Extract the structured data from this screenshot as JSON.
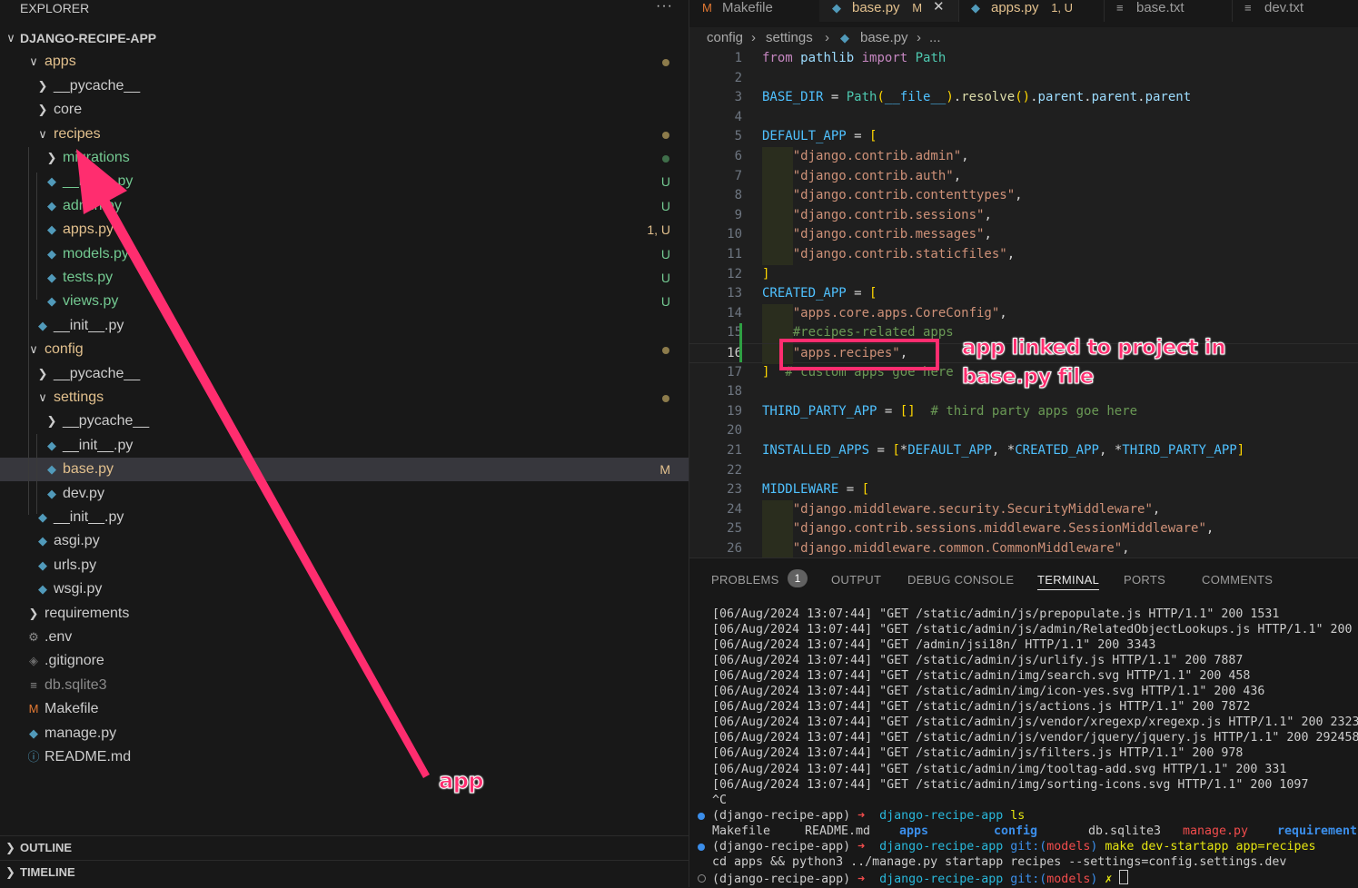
{
  "explorer": {
    "title": "EXPLORER",
    "more_actions": "···",
    "root": "DJANGO-RECIPE-APP",
    "items": [
      {
        "label": "apps",
        "type": "folder",
        "open": true,
        "indent": 1,
        "color": "#e2c08d",
        "dot": "#8c7b4b"
      },
      {
        "label": "__pycache__",
        "type": "folder",
        "open": false,
        "indent": 2,
        "color": "#cccccc"
      },
      {
        "label": "core",
        "type": "folder",
        "open": false,
        "indent": 2,
        "color": "#cccccc"
      },
      {
        "label": "recipes",
        "type": "folder",
        "open": true,
        "indent": 2,
        "color": "#e2c08d",
        "dot": "#8c7b4b"
      },
      {
        "label": "migrations",
        "type": "folder",
        "open": false,
        "indent": 3,
        "color": "#73c991",
        "dot": "#3f6e4a"
      },
      {
        "label": "__init__.py",
        "type": "py",
        "indent": 3,
        "color": "#73c991",
        "badge": "U",
        "badge_color": "#73c991"
      },
      {
        "label": "admin.py",
        "type": "py",
        "indent": 3,
        "color": "#73c991",
        "badge": "U",
        "badge_color": "#73c991"
      },
      {
        "label": "apps.py",
        "type": "py",
        "indent": 3,
        "color": "#e2c08d",
        "badge": "1, U",
        "badge_color": "#e2c08d"
      },
      {
        "label": "models.py",
        "type": "py",
        "indent": 3,
        "color": "#73c991",
        "badge": "U",
        "badge_color": "#73c991"
      },
      {
        "label": "tests.py",
        "type": "py",
        "indent": 3,
        "color": "#73c991",
        "badge": "U",
        "badge_color": "#73c991"
      },
      {
        "label": "views.py",
        "type": "py",
        "indent": 3,
        "color": "#73c991",
        "badge": "U",
        "badge_color": "#73c991"
      },
      {
        "label": "__init__.py",
        "type": "py",
        "indent": 2,
        "color": "#cccccc"
      },
      {
        "label": "config",
        "type": "folder",
        "open": true,
        "indent": 1,
        "color": "#e2c08d",
        "dot": "#8c7b4b"
      },
      {
        "label": "__pycache__",
        "type": "folder",
        "open": false,
        "indent": 2,
        "color": "#cccccc"
      },
      {
        "label": "settings",
        "type": "folder",
        "open": true,
        "indent": 2,
        "color": "#e2c08d",
        "dot": "#8c7b4b"
      },
      {
        "label": "__pycache__",
        "type": "folder",
        "open": false,
        "indent": 3,
        "color": "#cccccc"
      },
      {
        "label": "__init__.py",
        "type": "py",
        "indent": 3,
        "color": "#cccccc"
      },
      {
        "label": "base.py",
        "type": "py",
        "indent": 3,
        "color": "#e2c08d",
        "badge": "M",
        "badge_color": "#e2c08d",
        "selected": true
      },
      {
        "label": "dev.py",
        "type": "py",
        "indent": 3,
        "color": "#cccccc"
      },
      {
        "label": "__init__.py",
        "type": "py",
        "indent": 2,
        "color": "#cccccc"
      },
      {
        "label": "asgi.py",
        "type": "py",
        "indent": 2,
        "color": "#cccccc"
      },
      {
        "label": "urls.py",
        "type": "py",
        "indent": 2,
        "color": "#cccccc"
      },
      {
        "label": "wsgi.py",
        "type": "py",
        "indent": 2,
        "color": "#cccccc"
      },
      {
        "label": "requirements",
        "type": "folder",
        "open": false,
        "indent": 1,
        "color": "#cccccc"
      },
      {
        "label": ".env",
        "type": "gear",
        "indent": 1,
        "color": "#cccccc"
      },
      {
        "label": ".gitignore",
        "type": "git",
        "indent": 1,
        "color": "#cccccc"
      },
      {
        "label": "db.sqlite3",
        "type": "lines",
        "indent": 1,
        "color": "#8b8b8b"
      },
      {
        "label": "Makefile",
        "type": "make",
        "indent": 1,
        "color": "#cccccc"
      },
      {
        "label": "manage.py",
        "type": "py",
        "indent": 1,
        "color": "#cccccc"
      },
      {
        "label": "README.md",
        "type": "info",
        "indent": 1,
        "color": "#cccccc"
      }
    ],
    "outline": "OUTLINE",
    "timeline": "TIMELINE"
  },
  "tabs": [
    {
      "label": "Makefile",
      "icon": "make",
      "mod": "",
      "active": false,
      "color": "#9d9d9d"
    },
    {
      "label": "base.py",
      "icon": "py",
      "mod": "M",
      "active": true,
      "color": "#e2c08d"
    },
    {
      "label": "apps.py",
      "icon": "py",
      "mod": "1, U",
      "active": false,
      "color": "#e2c08d"
    },
    {
      "label": "base.txt",
      "icon": "lines",
      "mod": "",
      "active": false,
      "color": "#9d9d9d"
    },
    {
      "label": "dev.txt",
      "icon": "lines",
      "mod": "",
      "active": false,
      "color": "#9d9d9d"
    }
  ],
  "breadcrumb": [
    "config",
    "settings",
    "base.py",
    "..."
  ],
  "code": [
    "from pathlib import Path",
    "",
    "BASE_DIR = Path(__file__).resolve().parent.parent.parent",
    "",
    "DEFAULT_APP = [",
    "    \"django.contrib.admin\",",
    "    \"django.contrib.auth\",",
    "    \"django.contrib.contenttypes\",",
    "    \"django.contrib.sessions\",",
    "    \"django.contrib.messages\",",
    "    \"django.contrib.staticfiles\",",
    "]",
    "CREATED_APP = [",
    "    \"apps.core.apps.CoreConfig\",",
    "    #recipes-related apps",
    "    \"apps.recipes\",",
    "]  # custom apps goe here",
    "",
    "THIRD_PARTY_APP = []  # third party apps goe here",
    "",
    "INSTALLED_APPS = [*DEFAULT_APP, *CREATED_APP, *THIRD_PARTY_APP]",
    "",
    "MIDDLEWARE = [",
    "    \"django.middleware.security.SecurityMiddleware\",",
    "    \"django.contrib.sessions.middleware.SessionMiddleware\",",
    "    \"django.middleware.common.CommonMiddleware\","
  ],
  "current_line": 16,
  "panel": {
    "tabs": [
      "PROBLEMS",
      "OUTPUT",
      "DEBUG CONSOLE",
      "TERMINAL",
      "PORTS",
      "COMMENTS"
    ],
    "problems_count": "1",
    "active_tab": "TERMINAL",
    "log_lines": [
      "[06/Aug/2024 13:07:44] \"GET /static/admin/js/prepopulate.js HTTP/1.1\" 200 1531",
      "[06/Aug/2024 13:07:44] \"GET /static/admin/js/admin/RelatedObjectLookups.js HTTP/1.1\" 200",
      "[06/Aug/2024 13:07:44] \"GET /admin/jsi18n/ HTTP/1.1\" 200 3343",
      "[06/Aug/2024 13:07:44] \"GET /static/admin/js/urlify.js HTTP/1.1\" 200 7887",
      "[06/Aug/2024 13:07:44] \"GET /static/admin/img/search.svg HTTP/1.1\" 200 458",
      "[06/Aug/2024 13:07:44] \"GET /static/admin/img/icon-yes.svg HTTP/1.1\" 200 436",
      "[06/Aug/2024 13:07:44] \"GET /static/admin/js/actions.js HTTP/1.1\" 200 7872",
      "[06/Aug/2024 13:07:44] \"GET /static/admin/js/vendor/xregexp/xregexp.js HTTP/1.1\" 200 2323",
      "[06/Aug/2024 13:07:44] \"GET /static/admin/js/vendor/jquery/jquery.js HTTP/1.1\" 200 292458",
      "[06/Aug/2024 13:07:44] \"GET /static/admin/js/filters.js HTTP/1.1\" 200 978",
      "[06/Aug/2024 13:07:44] \"GET /static/admin/img/tooltag-add.svg HTTP/1.1\" 200 331",
      "[06/Aug/2024 13:07:44] \"GET /static/admin/img/sorting-icons.svg HTTP/1.1\" 200 1097",
      "^C"
    ],
    "prompt_env": "(django-recipe-app)",
    "prompt_arrow": "➜",
    "prompt_dir": "django-recipe-app",
    "git_label": "git:(",
    "git_branch": "models",
    "git_close": ")",
    "cmd1": "ls",
    "ls_output": [
      "Makefile",
      "README.md",
      "apps",
      "config",
      "db.sqlite3",
      "manage.py",
      "requirement"
    ],
    "cmd2": "make dev-startapp app=recipes",
    "cmd2_output": "cd apps && python3 ../manage.py startapp recipes --settings=config.settings.dev",
    "cmd3_suffix": "✗"
  },
  "annotations": {
    "app_label": "app",
    "base_label_line1": "app linked to project in",
    "base_label_line2": "base.py file",
    "color": "#ff2d6f"
  }
}
